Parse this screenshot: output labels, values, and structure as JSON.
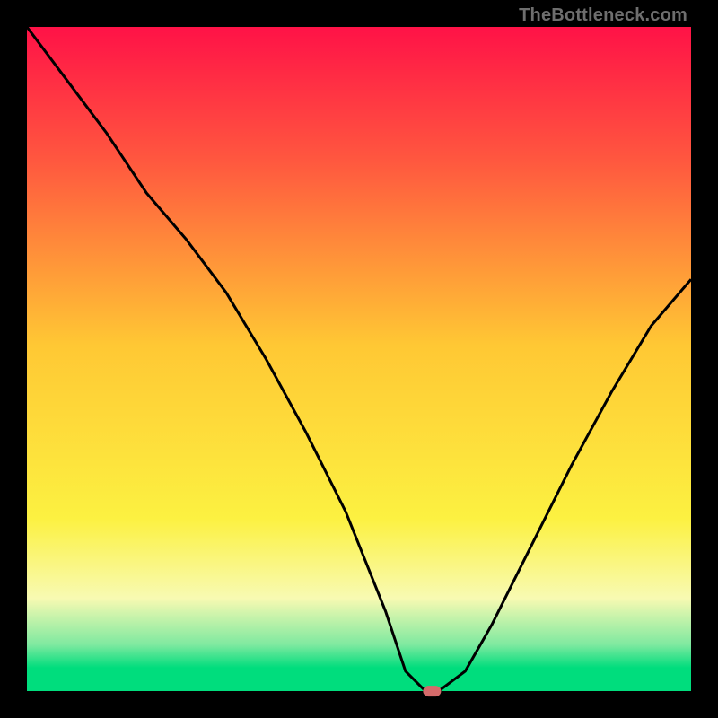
{
  "watermark": "TheBottleneck.com",
  "colors": {
    "bg": "#000000",
    "grad_top": "#ff1247",
    "grad_upper": "#ff573f",
    "grad_mid": "#ffc834",
    "grad_lower": "#fcf141",
    "grad_pale": "#f8fab2",
    "grad_green_soft": "#7fe9a0",
    "grad_green": "#00dd7d",
    "line": "#000000",
    "marker": "#d46a6a"
  },
  "chart_data": {
    "type": "line",
    "title": "",
    "xlabel": "",
    "ylabel": "",
    "xlim": [
      0,
      100
    ],
    "ylim": [
      0,
      100
    ],
    "series": [
      {
        "name": "bottleneck-v-curve",
        "x": [
          0,
          6,
          12,
          18,
          24,
          30,
          36,
          42,
          48,
          54,
          57,
          60,
          62,
          66,
          70,
          76,
          82,
          88,
          94,
          100
        ],
        "y": [
          100,
          92,
          84,
          75,
          68,
          60,
          50,
          39,
          27,
          12,
          3,
          0,
          0,
          3,
          10,
          22,
          34,
          45,
          55,
          62
        ]
      }
    ],
    "marker": {
      "x": 61,
      "y": 0,
      "w": 2.6,
      "h": 1.6
    }
  }
}
